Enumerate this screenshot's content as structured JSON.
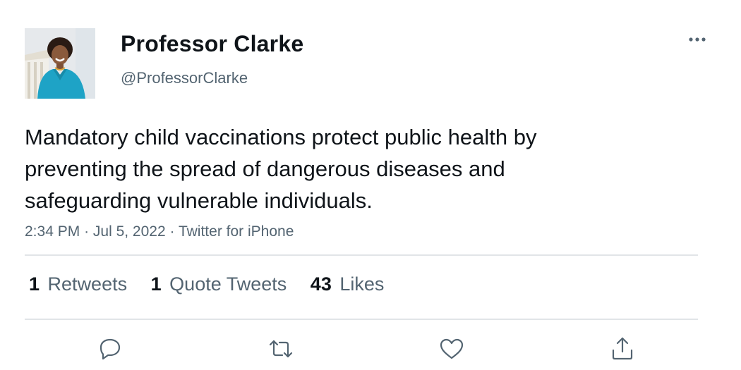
{
  "author": {
    "display_name": "Professor Clarke",
    "handle": "@ProfessorClarke"
  },
  "tweet": {
    "text_lines": [
      "Mandatory child vaccinations protect public health by",
      "preventing the spread of dangerous diseases and",
      "safeguarding vulnerable individuals."
    ],
    "time": "2:34 PM",
    "date": "Jul 5, 2022",
    "separator": "·",
    "source": "Twitter for iPhone"
  },
  "stats": {
    "retweets": {
      "count": "1",
      "label": "Retweets"
    },
    "quote_tweets": {
      "count": "1",
      "label": "Quote Tweets"
    },
    "likes": {
      "count": "43",
      "label": "Likes"
    }
  },
  "actions": {
    "icons": [
      "reply-icon",
      "retweet-icon",
      "like-icon",
      "share-icon"
    ]
  },
  "colors": {
    "text_primary": "#0f1419",
    "text_secondary": "#536471",
    "divider": "#e1e5e8",
    "icon": "#536471"
  }
}
